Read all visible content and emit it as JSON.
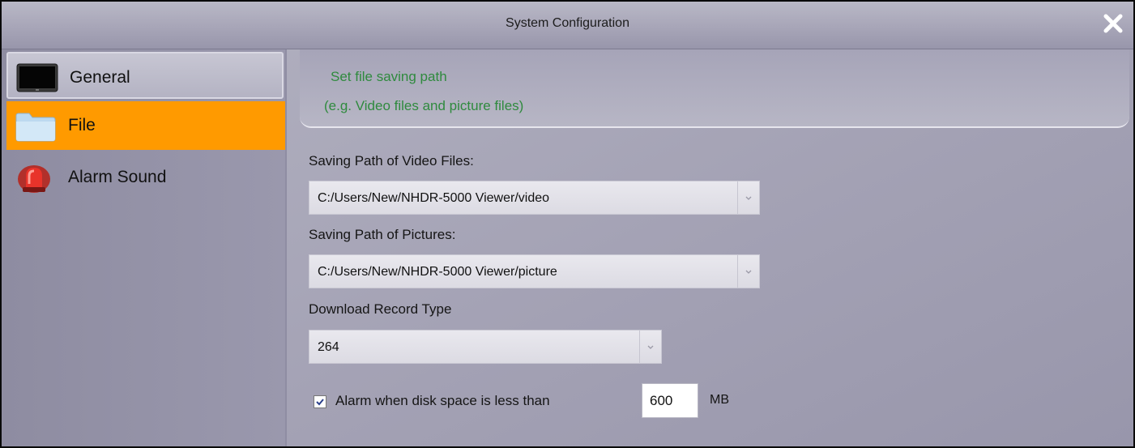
{
  "window": {
    "title": "System Configuration"
  },
  "sidebar": {
    "items": [
      {
        "label": "General",
        "icon": "monitor-icon",
        "selected": false
      },
      {
        "label": "File",
        "icon": "folder-icon",
        "selected": true
      },
      {
        "label": "Alarm Sound",
        "icon": "alarm-light-icon",
        "selected": false
      }
    ]
  },
  "main": {
    "header": {
      "title": "Set file saving path",
      "subtitle": "(e.g. Video files and picture files)"
    },
    "video_path": {
      "label": "Saving Path of Video Files:",
      "value": "C:/Users/New/NHDR-5000 Viewer/video"
    },
    "picture_path": {
      "label": "Saving Path of Pictures:",
      "value": "C:/Users/New/NHDR-5000 Viewer/picture"
    },
    "record_type": {
      "label": "Download Record Type",
      "value": "264"
    },
    "disk_alarm": {
      "checked": true,
      "label": "Alarm when disk space is less than",
      "value": "600",
      "unit": "MB"
    }
  },
  "colors": {
    "selected_item": "#ff9a00",
    "header_text": "#2f8a3e"
  }
}
